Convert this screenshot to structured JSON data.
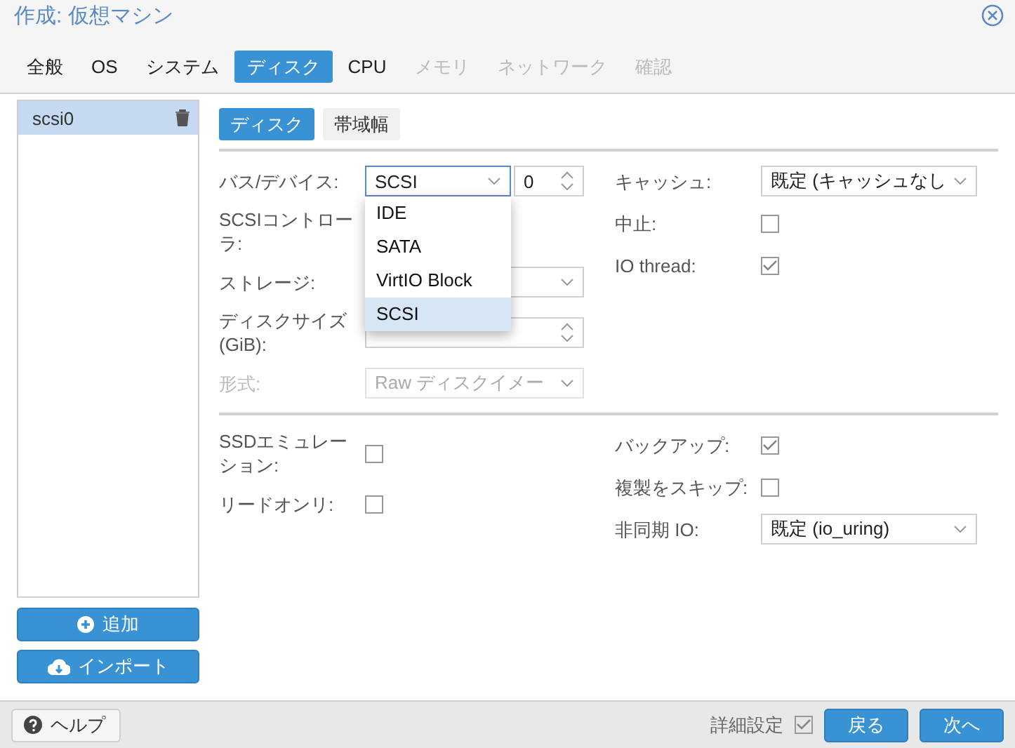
{
  "window": {
    "title": "作成: 仮想マシン"
  },
  "tabs": [
    {
      "label": "全般",
      "selected": false,
      "disabled": false
    },
    {
      "label": "OS",
      "selected": false,
      "disabled": false
    },
    {
      "label": "システム",
      "selected": false,
      "disabled": false
    },
    {
      "label": "ディスク",
      "selected": true,
      "disabled": false
    },
    {
      "label": "CPU",
      "selected": false,
      "disabled": false
    },
    {
      "label": "メモリ",
      "selected": false,
      "disabled": true
    },
    {
      "label": "ネットワーク",
      "selected": false,
      "disabled": true
    },
    {
      "label": "確認",
      "selected": false,
      "disabled": true
    }
  ],
  "disks": [
    {
      "label": "scsi0",
      "selected": true
    }
  ],
  "disk_buttons": [
    {
      "kind": "add",
      "label": "追加"
    },
    {
      "kind": "import",
      "label": "インポート"
    }
  ],
  "subtabs": [
    {
      "label": "ディスク",
      "selected": true
    },
    {
      "label": "帯域幅",
      "selected": false
    }
  ],
  "left_fields": [
    {
      "kind": "select",
      "label": "バス/デバイス:",
      "value": "SCSI",
      "spin_value": "0",
      "disabled": false
    },
    {
      "kind": "display",
      "label": "SCSIコントローラ:",
      "disabled": false
    },
    {
      "kind": "select",
      "label": "ストレージ:",
      "disabled": false
    },
    {
      "kind": "number",
      "label": "ディスクサイズ (GiB):",
      "disabled": false
    },
    {
      "kind": "select",
      "label": "形式:",
      "value": "Raw ディスクイメー",
      "disabled": true
    }
  ],
  "bus_dropdown": [
    {
      "label": "IDE",
      "selected": false
    },
    {
      "label": "SATA",
      "selected": false
    },
    {
      "label": "VirtIO Block",
      "selected": false
    },
    {
      "label": "SCSI",
      "selected": true
    }
  ],
  "right_fields": [
    {
      "kind": "select",
      "label": "キャッシュ:",
      "value": "既定 (キャッシュなし"
    },
    {
      "kind": "checkbox",
      "label": "中止:",
      "checked": false
    },
    {
      "kind": "checkbox",
      "label": "IO thread:",
      "checked": true
    }
  ],
  "advanced_left": [
    {
      "kind": "checkbox",
      "label": "SSDエミュレーション:",
      "checked": false
    },
    {
      "kind": "checkbox",
      "label": "リードオンリ:",
      "checked": false
    }
  ],
  "advanced_right": [
    {
      "kind": "checkbox",
      "label": "バックアップ:",
      "checked": true
    },
    {
      "kind": "checkbox",
      "label": "複製をスキップ:",
      "checked": false
    },
    {
      "kind": "select",
      "label": "非同期 IO:",
      "value": "既定 (io_uring)"
    }
  ],
  "footer": {
    "help": "ヘルプ",
    "advanced": {
      "label": "詳細設定",
      "checked": true
    },
    "buttons": [
      "戻る",
      "次へ"
    ]
  }
}
